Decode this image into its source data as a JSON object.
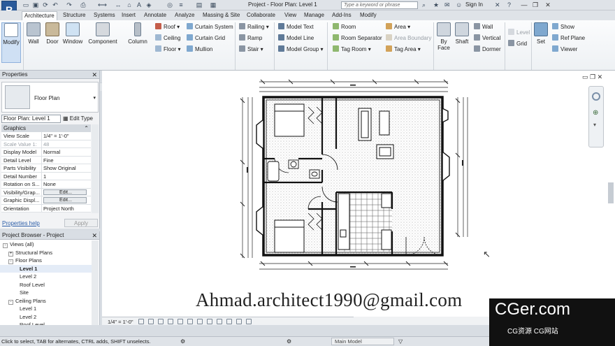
{
  "window": {
    "title": "Project - Floor Plan: Level 1",
    "search_placeholder": "Type a keyword or phrase",
    "sign_in": "Sign In",
    "app_letter": "R"
  },
  "ribbon_tabs": [
    "Architecture",
    "Structure",
    "Systems",
    "Insert",
    "Annotate",
    "Analyze",
    "Massing & Site",
    "Collaborate",
    "View",
    "Manage",
    "Add-Ins",
    "Modify"
  ],
  "ribbon": {
    "modify": "Modify",
    "wall": "Wall",
    "door": "Door",
    "window": "Window",
    "component": "Component",
    "column": "Column",
    "roof": "Roof",
    "ceiling": "Ceiling",
    "floor": "Floor",
    "curtain_system": "Curtain System",
    "curtain_grid": "Curtain Grid",
    "mullion": "Mullion",
    "railing": "Railing",
    "ramp": "Ramp",
    "stair": "Stair",
    "model_text": "Model Text",
    "model_line": "Model Line",
    "model_group": "Model Group",
    "room": "Room",
    "room_separator": "Room Separator",
    "tag_room": "Tag Room",
    "area": "Area",
    "area_boundary": "Area Boundary",
    "tag_area": "Tag Area",
    "by_face": "By Face",
    "shaft": "Shaft",
    "wall_opening": "Wall",
    "vertical": "Vertical",
    "dormer": "Dormer",
    "level": "Level",
    "grid": "Grid",
    "set": "Set",
    "show": "Show",
    "ref_plane": "Ref Plane",
    "viewer": "Viewer"
  },
  "properties": {
    "title": "Properties",
    "type_name": "Floor Plan",
    "instance": "Floor Plan: Level 1",
    "edit_type": "Edit Type",
    "group": "Graphics",
    "rows": [
      {
        "k": "View Scale",
        "v": "1/4\" = 1'-0\""
      },
      {
        "k": "Scale Value  1:",
        "v": "48"
      },
      {
        "k": "Display Model",
        "v": "Normal"
      },
      {
        "k": "Detail Level",
        "v": "Fine"
      },
      {
        "k": "Parts Visibility",
        "v": "Show Original"
      },
      {
        "k": "Detail Number",
        "v": "1"
      },
      {
        "k": "Rotation on S...",
        "v": "None"
      },
      {
        "k": "Visibility/Grap...",
        "v": "Edit..."
      },
      {
        "k": "Graphic Displ...",
        "v": "Edit..."
      },
      {
        "k": "Orientation",
        "v": "Project North"
      }
    ],
    "help": "Properties help",
    "apply": "Apply"
  },
  "browser": {
    "title": "Project Browser - Project",
    "nodes": [
      {
        "label": "Views (all)",
        "indent": 0,
        "toggle": "-"
      },
      {
        "label": "Structural Plans",
        "indent": 1,
        "toggle": "+"
      },
      {
        "label": "Floor Plans",
        "indent": 1,
        "toggle": "-"
      },
      {
        "label": "Level 1",
        "indent": 3,
        "toggle": "",
        "selected": true
      },
      {
        "label": "Level 2",
        "indent": 3,
        "toggle": ""
      },
      {
        "label": "Roof Level",
        "indent": 3,
        "toggle": ""
      },
      {
        "label": "Site",
        "indent": 3,
        "toggle": ""
      },
      {
        "label": "Ceiling Plans",
        "indent": 1,
        "toggle": "-"
      },
      {
        "label": "Level 1",
        "indent": 3,
        "toggle": ""
      },
      {
        "label": "Level 2",
        "indent": 3,
        "toggle": ""
      },
      {
        "label": "Roof Level",
        "indent": 3,
        "toggle": ""
      }
    ]
  },
  "canvas": {
    "email": "Ahmad.architect1990@gmail.com",
    "view_scale": "1/4\" = 1'-0\""
  },
  "watermark": {
    "big": "CGer.com",
    "small": "CG资源 CG网站"
  },
  "status": {
    "text": "Click to select, TAB for alternates, CTRL adds, SHIFT unselects.",
    "model": "Main Model"
  }
}
